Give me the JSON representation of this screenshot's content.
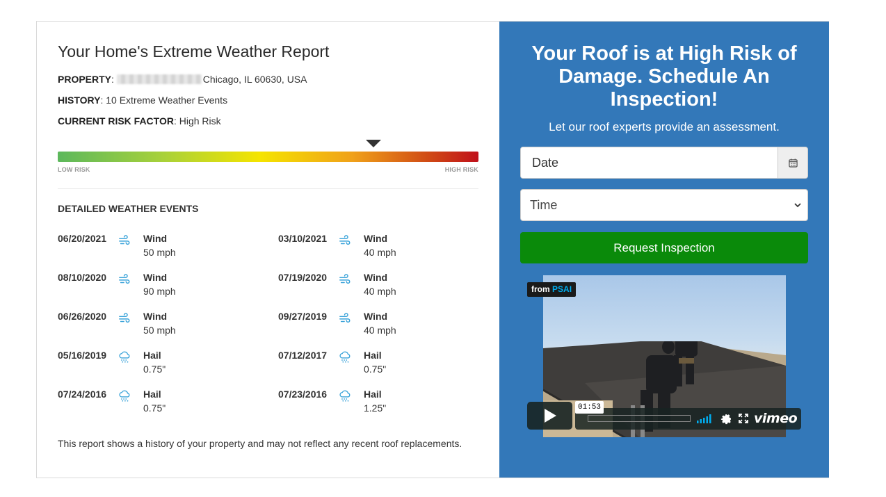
{
  "report": {
    "title": "Your Home's Extreme Weather Report",
    "property_label": "PROPERTY",
    "property_value": "Chicago, IL 60630, USA",
    "history_label": "HISTORY",
    "history_value": "10 Extreme Weather Events",
    "risk_label": "CURRENT RISK FACTOR",
    "risk_value": "High Risk",
    "risk_scale_low": "LOW RISK",
    "risk_scale_high": "HIGH RISK",
    "risk_level_fraction": 0.75,
    "events_title": "DETAILED WEATHER EVENTS",
    "footnote": "This report shows a history of your property and may not reflect any recent roof replacements."
  },
  "events": [
    {
      "date": "06/20/2021",
      "type": "Wind",
      "value": "50 mph",
      "icon": "wind-icon"
    },
    {
      "date": "03/10/2021",
      "type": "Wind",
      "value": "40 mph",
      "icon": "wind-icon"
    },
    {
      "date": "08/10/2020",
      "type": "Wind",
      "value": "90 mph",
      "icon": "wind-icon"
    },
    {
      "date": "07/19/2020",
      "type": "Wind",
      "value": "40 mph",
      "icon": "wind-icon"
    },
    {
      "date": "06/26/2020",
      "type": "Wind",
      "value": "50 mph",
      "icon": "wind-icon"
    },
    {
      "date": "09/27/2019",
      "type": "Wind",
      "value": "40 mph",
      "icon": "wind-icon"
    },
    {
      "date": "05/16/2019",
      "type": "Hail",
      "value": "0.75\"",
      "icon": "hail-icon"
    },
    {
      "date": "07/12/2017",
      "type": "Hail",
      "value": "0.75\"",
      "icon": "hail-icon"
    },
    {
      "date": "07/24/2016",
      "type": "Hail",
      "value": "0.75\"",
      "icon": "hail-icon"
    },
    {
      "date": "07/23/2016",
      "type": "Hail",
      "value": "1.25\"",
      "icon": "hail-icon"
    }
  ],
  "cta": {
    "title": "Your Roof is at High Risk of Damage. Schedule An Inspection!",
    "subtitle": "Let our roof experts provide an assessment.",
    "date_placeholder": "Date",
    "time_label": "Time",
    "button_label": "Request Inspection"
  },
  "video": {
    "from_prefix": "from",
    "from_brand": "PSAI",
    "timecode": "01:53",
    "player_brand": "vimeo"
  },
  "colors": {
    "panel_blue": "#3378b9",
    "button_green": "#0a8a0a",
    "icon_blue": "#3aa3d9",
    "vimeo_blue": "#00adef"
  }
}
